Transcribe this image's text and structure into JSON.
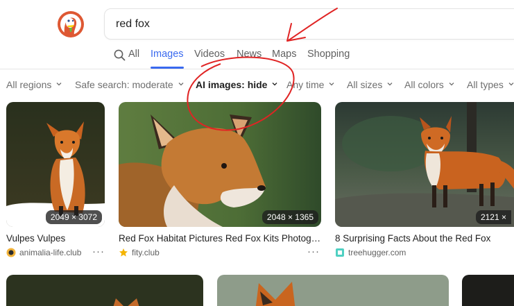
{
  "search": {
    "query": "red fox"
  },
  "tabs": [
    {
      "label": "All"
    },
    {
      "label": "Images"
    },
    {
      "label": "Videos"
    },
    {
      "label": "News"
    },
    {
      "label": "Maps"
    },
    {
      "label": "Shopping"
    }
  ],
  "active_tab": "Images",
  "filters": [
    {
      "label": "All regions"
    },
    {
      "label": "Safe search: moderate"
    },
    {
      "label": "AI images: hide"
    },
    {
      "label": "Any time"
    },
    {
      "label": "All sizes"
    },
    {
      "label": "All colors"
    },
    {
      "label": "All types"
    }
  ],
  "results": [
    {
      "title": "Vulpes Vulpes",
      "dims": "2049 × 3072",
      "source": "animalia-life.club"
    },
    {
      "title": "Red Fox Habitat Pictures Red Fox Kits Photogra...",
      "dims": "2048 × 1365",
      "source": "fity.club"
    },
    {
      "title": "8 Surprising Facts About the Red Fox",
      "dims": "2121 ×",
      "source": "treehugger.com"
    }
  ],
  "more_label": "···",
  "colors": {
    "accent": "#3969ef",
    "annotation": "#e02424",
    "logo": "#de5833"
  },
  "icons": [
    "duckduckgo-logo",
    "search-icon",
    "chevron-down-icon",
    "ellipsis-icon",
    "favicon"
  ]
}
